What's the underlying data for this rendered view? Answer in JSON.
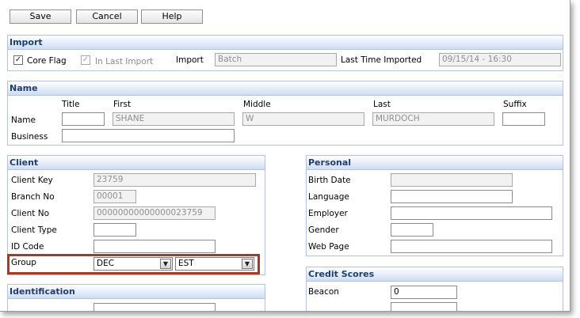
{
  "toolbar": {
    "save_label": "Save",
    "cancel_label": "Cancel",
    "help_label": "Help"
  },
  "import": {
    "header": "Import",
    "core_flag_label": "Core Flag",
    "in_last_import_label": "In Last Import",
    "import_label": "Import",
    "import_value": "Batch",
    "last_time_imported_label": "Last Time Imported",
    "last_time_imported_value": "09/15/14 - 16:30"
  },
  "name": {
    "header": "Name",
    "title_col": "Title",
    "first_col": "First",
    "middle_col": "Middle",
    "last_col": "Last",
    "suffix_col": "Suffix",
    "name_label": "Name",
    "first_value": "SHANE",
    "middle_value": "W",
    "last_value": "MURDOCH",
    "business_label": "Business"
  },
  "client": {
    "header": "Client",
    "client_key_label": "Client Key",
    "client_key_value": "23759",
    "branch_no_label": "Branch No",
    "branch_no_value": "00001",
    "client_no_label": "Client No",
    "client_no_value": "00000000000000023759",
    "client_type_label": "Client Type",
    "id_code_label": "ID Code",
    "group_label": "Group",
    "group_value_1": "DEC",
    "group_value_2": "EST"
  },
  "personal": {
    "header": "Personal",
    "birth_date_label": "Birth Date",
    "language_label": "Language",
    "employer_label": "Employer",
    "gender_label": "Gender",
    "web_page_label": "Web Page"
  },
  "identification": {
    "header": "Identification"
  },
  "credit_scores": {
    "header": "Credit Scores",
    "beacon_label": "Beacon",
    "beacon_value": "0"
  },
  "icons": {
    "check": "✓",
    "dropdown": "▼"
  },
  "colors": {
    "header_text": "#1f3e6e",
    "panel_border": "#b3c4dc",
    "highlight": "#a33a2a"
  }
}
